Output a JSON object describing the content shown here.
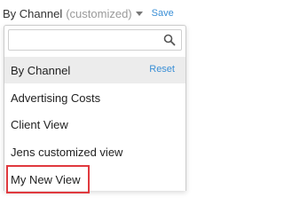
{
  "view_selector": {
    "current_view": "By Channel",
    "status": "(customized)",
    "save_label": "Save"
  },
  "dropdown": {
    "search": {
      "value": "",
      "placeholder": ""
    },
    "items": [
      {
        "label": "By Channel",
        "selected": true,
        "action_label": "Reset"
      },
      {
        "label": "Advertising Costs",
        "selected": false
      },
      {
        "label": "Client View",
        "selected": false
      },
      {
        "label": "Jens customized view",
        "selected": false
      },
      {
        "label": "My New View",
        "selected": false,
        "highlighted": true
      }
    ]
  },
  "colors": {
    "link": "#3a8fd6",
    "highlight_border": "#e0393e",
    "selected_row": "#ececec",
    "muted_text": "#9a9a9a"
  }
}
